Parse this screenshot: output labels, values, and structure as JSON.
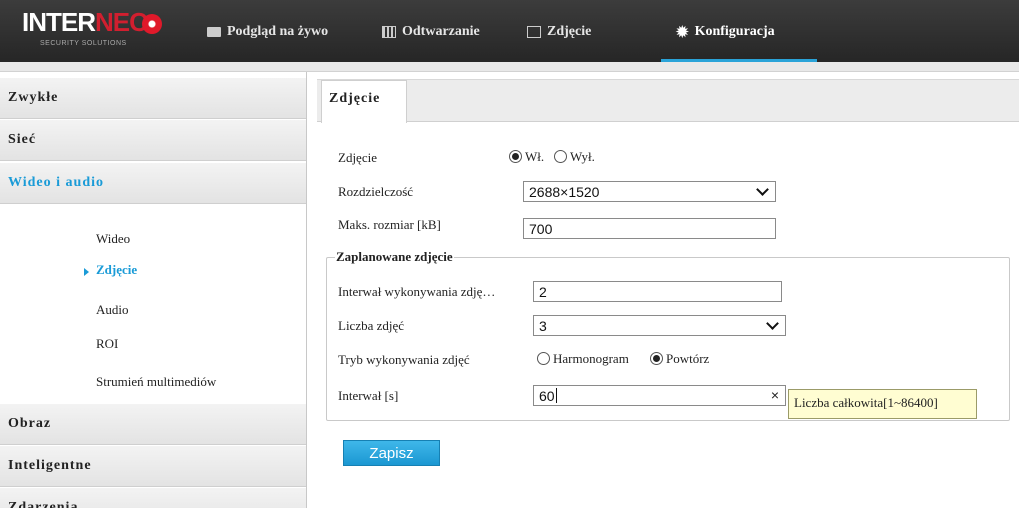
{
  "header": {
    "logo": {
      "brand_prefix": "INTER",
      "brand_suffix": "NEC",
      "tagline": "SECURITY SOLUTIONS"
    },
    "nav": [
      {
        "label": "Podgląd na żywo",
        "icon": "monitor-icon"
      },
      {
        "label": "Odtwarzanie",
        "icon": "film-icon"
      },
      {
        "label": "Zdjęcie",
        "icon": "image-icon"
      },
      {
        "label": "Konfiguracja",
        "icon": "gear-icon",
        "active": true
      }
    ],
    "accent_color": "#2aa3d8"
  },
  "sidebar": {
    "sections": [
      {
        "label": "Zwykłe"
      },
      {
        "label": "Sieć"
      },
      {
        "label": "Wideo i audio",
        "active": true
      },
      {
        "label": "Obraz"
      },
      {
        "label": "Inteligentne"
      },
      {
        "label": "Zdarzenia"
      }
    ],
    "subitems": [
      {
        "label": "Wideo"
      },
      {
        "label": "Zdjęcie",
        "active": true
      },
      {
        "label": "Audio"
      },
      {
        "label": "ROI"
      },
      {
        "label": "Strumień multimediów"
      }
    ],
    "active_color": "#1a9bd7"
  },
  "content": {
    "tab": "Zdjęcie",
    "snapshot": {
      "label": "Zdjęcie",
      "option_on": "Wł.",
      "option_off": "Wył.",
      "selected": "Wł."
    },
    "resolution": {
      "label": "Rozdzielczość",
      "value": "2688×1520"
    },
    "max_size": {
      "label": "Maks. rozmiar [kB]",
      "value": "700"
    },
    "scheduled": {
      "legend": "Zaplanowane zdjęcie",
      "capture_interval": {
        "label": "Interwał wykonywania zdję…",
        "value": "2"
      },
      "count": {
        "label": "Liczba zdjęć",
        "value": "3"
      },
      "mode": {
        "label": "Tryb wykonywania zdjęć",
        "option_schedule": "Harmonogram",
        "option_repeat": "Powtórz",
        "selected": "Powtórz"
      },
      "interval": {
        "label": "Interwał [s]",
        "value": "60",
        "clear": "×"
      },
      "tooltip": "Liczba całkowita[1~86400]"
    },
    "save_label": "Zapisz"
  }
}
